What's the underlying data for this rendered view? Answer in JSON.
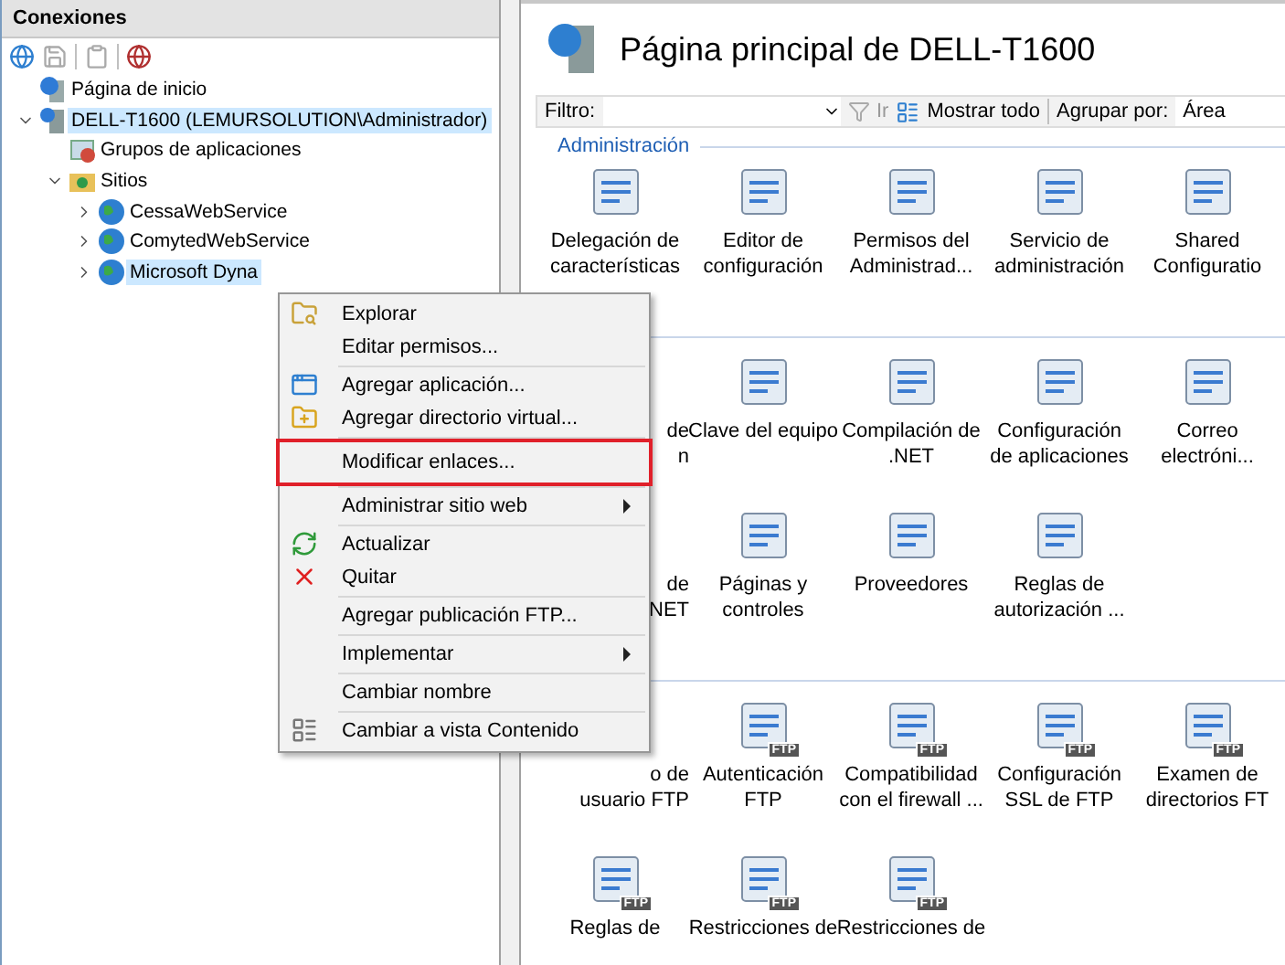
{
  "connections": {
    "title": "Conexiones",
    "tree": [
      {
        "label": "Página de inicio",
        "kind": "home",
        "selected": false
      },
      {
        "label": "DELL-T1600 (LEMURSOLUTION\\Administrador)",
        "kind": "server",
        "selected": true,
        "expanded": true,
        "children": [
          {
            "label": "Grupos de aplicaciones",
            "kind": "pool",
            "selected": false
          },
          {
            "label": "Sitios",
            "kind": "folder",
            "selected": false,
            "expanded": true,
            "children": [
              {
                "label": "CessaWebService",
                "kind": "site",
                "selected": false,
                "expanded": false
              },
              {
                "label": "ComytedWebService",
                "kind": "site",
                "selected": false,
                "expanded": false
              },
              {
                "label": "Microsoft Dyna",
                "kind": "site",
                "selected": true,
                "expanded": false
              }
            ]
          }
        ]
      }
    ]
  },
  "main": {
    "title": "Página principal de DELL-T1600",
    "filter": {
      "label": "Filtro:",
      "go": "Ir",
      "show_all": "Mostrar todo",
      "group_label": "Agrupar por:",
      "group_value": "Área"
    },
    "sections": [
      {
        "title": "Administración",
        "rows": [
          [
            {
              "lines": [
                "Delegación de",
                "características"
              ]
            },
            {
              "lines": [
                "Editor de",
                "configuración"
              ]
            },
            {
              "lines": [
                "Permisos del",
                "Administrad..."
              ]
            },
            {
              "lines": [
                "Servicio de",
                "administración"
              ]
            },
            {
              "lines": [
                "Shared",
                "Configuratio"
              ]
            }
          ]
        ]
      },
      {
        "rows": [
          [
            {
              "lines": [
                "de",
                "n"
              ],
              "covered": true
            },
            {
              "lines": [
                "Clave del equipo"
              ]
            },
            {
              "lines": [
                "Compilación de",
                ".NET"
              ]
            },
            {
              "lines": [
                "Configuración",
                "de aplicaciones"
              ]
            },
            {
              "lines": [
                "Correo",
                "electróni..."
              ]
            }
          ],
          [
            {
              "lines": [
                "de",
                "NET"
              ],
              "covered": true
            },
            {
              "lines": [
                "Páginas y",
                "controles"
              ]
            },
            {
              "lines": [
                "Proveedores"
              ]
            },
            {
              "lines": [
                "Reglas de",
                "autorización ..."
              ]
            }
          ]
        ]
      },
      {
        "rows": [
          [
            {
              "lines": [
                "o de",
                "usuario FTP"
              ],
              "covered": true
            },
            {
              "lines": [
                "Autenticación",
                "FTP"
              ],
              "badge": "FTP"
            },
            {
              "lines": [
                "Compatibilidad",
                "con el firewall ..."
              ],
              "badge": "FTP"
            },
            {
              "lines": [
                "Configuración",
                "SSL de FTP"
              ],
              "badge": "FTP"
            },
            {
              "lines": [
                "Examen de",
                "directorios FT"
              ],
              "badge": "FTP"
            }
          ],
          [
            {
              "lines": [
                "Reglas de"
              ],
              "badge": "FTP"
            },
            {
              "lines": [
                "Restricciones de"
              ],
              "badge": "FTP"
            },
            {
              "lines": [
                "Restricciones de"
              ],
              "badge": "FTP"
            }
          ]
        ]
      }
    ]
  },
  "context_menu": {
    "groups": [
      [
        {
          "label": "Explorar",
          "has_icon": true
        },
        {
          "label": "Editar permisos...",
          "has_icon": false
        }
      ],
      [
        {
          "label": "Agregar aplicación...",
          "has_icon": true
        },
        {
          "label": "Agregar directorio virtual...",
          "has_icon": true
        }
      ],
      [
        {
          "label": "Modificar enlaces...",
          "has_icon": false,
          "highlighted": true
        }
      ],
      [
        {
          "label": "Administrar sitio web",
          "has_icon": false,
          "submenu": true
        }
      ],
      [
        {
          "label": "Actualizar",
          "has_icon": true
        },
        {
          "label": "Quitar",
          "has_icon": true
        }
      ],
      [
        {
          "label": "Agregar publicación FTP...",
          "has_icon": false
        }
      ],
      [
        {
          "label": "Implementar",
          "has_icon": false,
          "submenu": true
        }
      ],
      [
        {
          "label": "Cambiar nombre",
          "has_icon": false
        }
      ],
      [
        {
          "label": "Cambiar a vista Contenido",
          "has_icon": true
        }
      ]
    ]
  }
}
